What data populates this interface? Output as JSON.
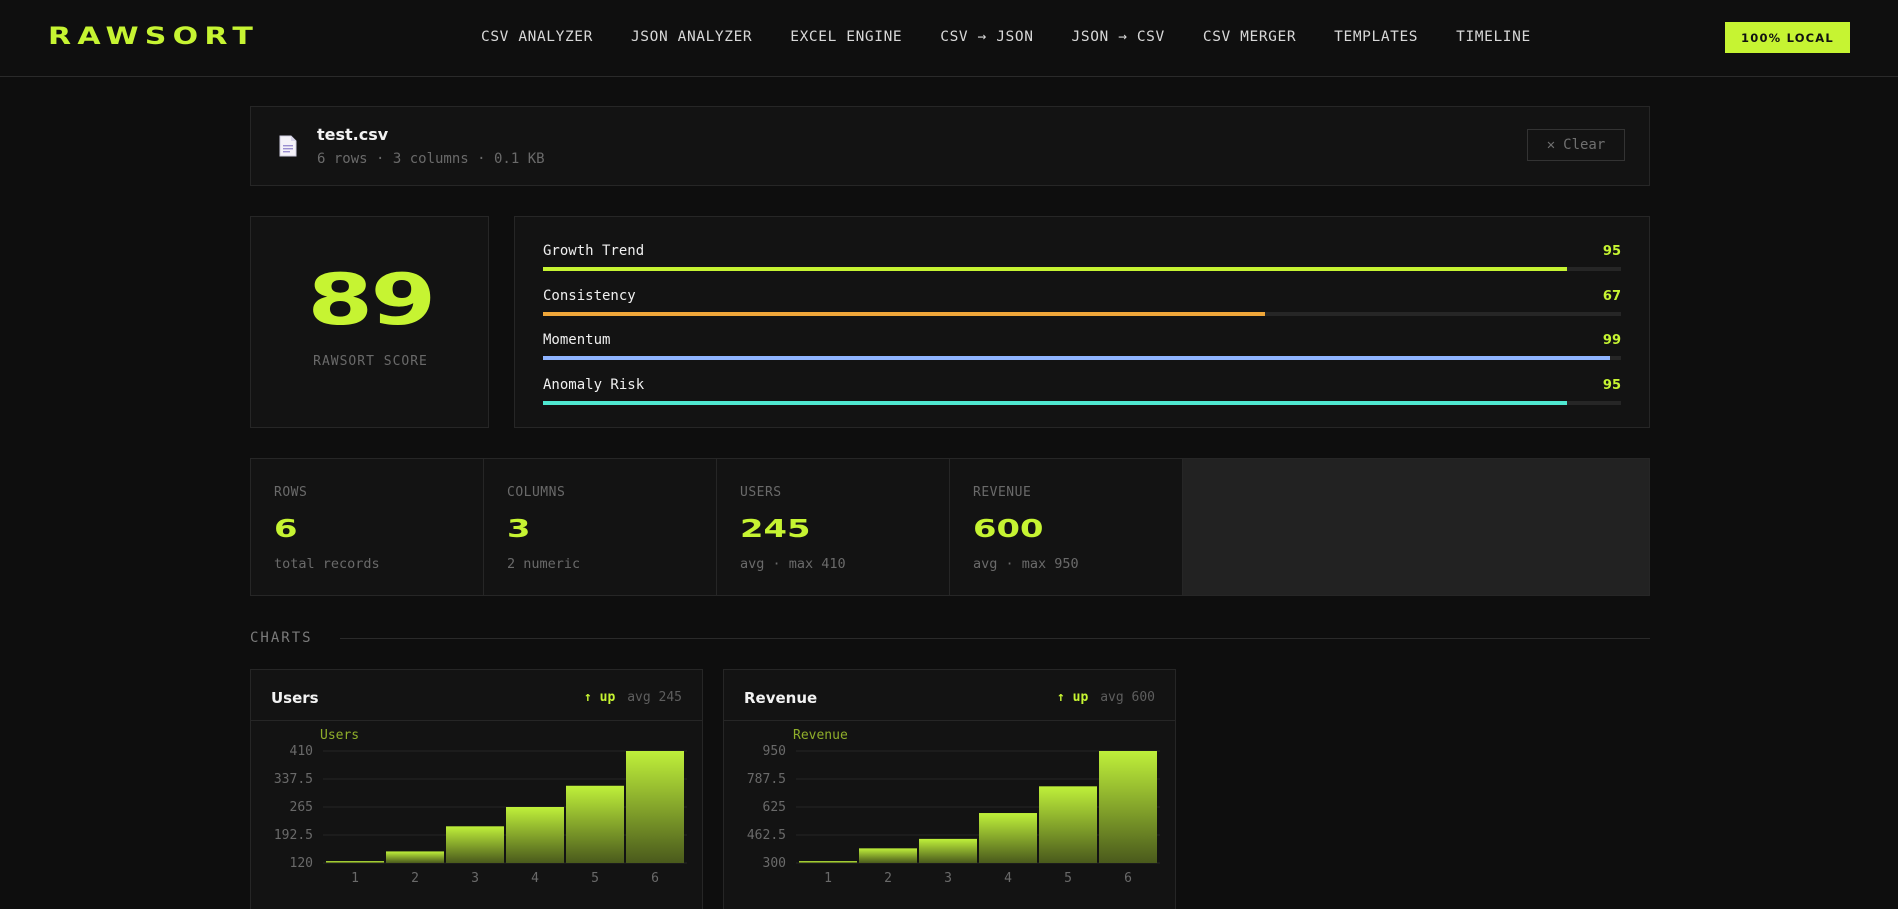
{
  "app": {
    "logo": "RAWSORT",
    "nav": [
      "CSV ANALYZER",
      "JSON ANALYZER",
      "EXCEL ENGINE",
      "CSV → JSON",
      "JSON → CSV",
      "CSV MERGER",
      "TEMPLATES",
      "TIMELINE"
    ],
    "badge": "100% LOCAL"
  },
  "file": {
    "name": "test.csv",
    "meta": "6 rows · 3 columns · 0.1 KB",
    "clear_label": "Clear",
    "icon": "document-icon"
  },
  "score": {
    "value": "89",
    "label": "RAWSORT SCORE"
  },
  "metrics": [
    {
      "label": "Growth Trend",
      "value": "95",
      "level": 95,
      "color": "#c6f432"
    },
    {
      "label": "Consistency",
      "value": "67",
      "level": 67,
      "color": "#f0a73a"
    },
    {
      "label": "Momentum",
      "value": "99",
      "level": 99,
      "color": "#8fb4ff"
    },
    {
      "label": "Anomaly Risk",
      "value": "95",
      "level": 95,
      "color": "#4fe8d0"
    }
  ],
  "stats": [
    {
      "label": "ROWS",
      "value": "6",
      "sub": "total records"
    },
    {
      "label": "COLUMNS",
      "value": "3",
      "sub": "2 numeric"
    },
    {
      "label": "USERS",
      "value": "245",
      "sub": "avg · max 410"
    },
    {
      "label": "REVENUE",
      "value": "600",
      "sub": "avg · max 950"
    }
  ],
  "section_title": "CHARTS",
  "chart_data": [
    {
      "type": "bar",
      "title": "Users",
      "trend": "↑ up",
      "avg": "avg 245",
      "categories": [
        "1",
        "2",
        "3",
        "4",
        "5",
        "6"
      ],
      "series": [
        {
          "name": "Users",
          "values": [
            125,
            150,
            215,
            265,
            320,
            410
          ]
        }
      ],
      "yticks": [
        "410",
        "337.5",
        "265",
        "192.5",
        "120"
      ],
      "ylim": [
        120,
        410
      ],
      "grid": true
    },
    {
      "type": "bar",
      "title": "Revenue",
      "trend": "↑ up",
      "avg": "avg 600",
      "categories": [
        "1",
        "2",
        "3",
        "4",
        "5",
        "6"
      ],
      "series": [
        {
          "name": "Revenue",
          "values": [
            310,
            385,
            440,
            590,
            745,
            950
          ]
        }
      ],
      "yticks": [
        "950",
        "787.5",
        "625",
        "462.5",
        "300"
      ],
      "ylim": [
        300,
        950
      ],
      "grid": true
    }
  ],
  "colors": {
    "accent": "#c6f432",
    "bg": "#0e0e0e",
    "panel": "#131313"
  }
}
